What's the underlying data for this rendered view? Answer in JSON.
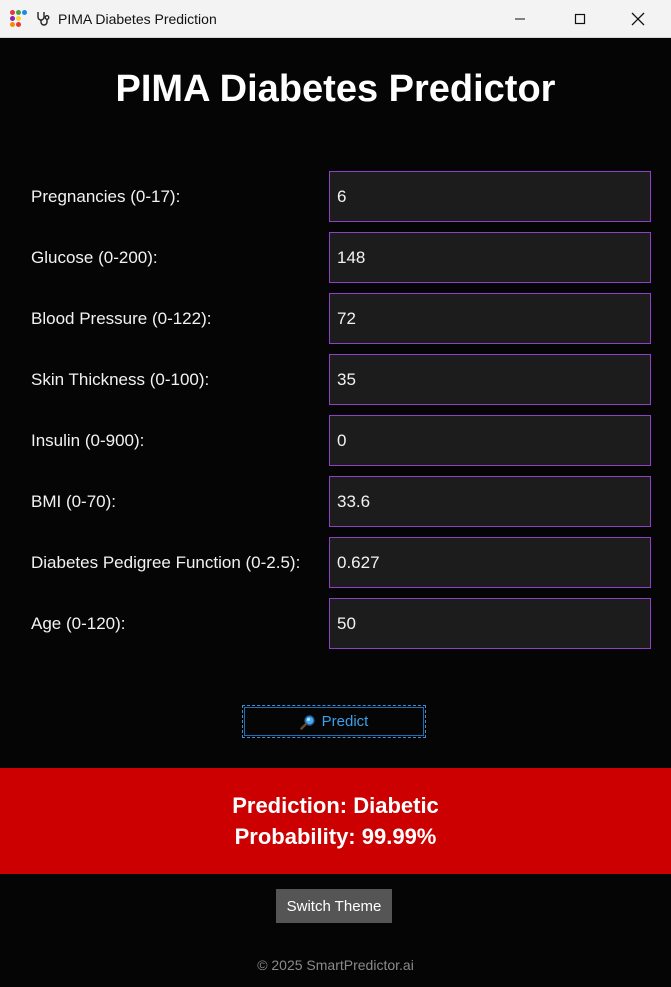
{
  "window": {
    "title": "PIMA Diabetes Prediction"
  },
  "app": {
    "heading": "PIMA Diabetes Predictor"
  },
  "fields": [
    {
      "label": "Pregnancies (0-17):",
      "value": "6"
    },
    {
      "label": "Glucose (0-200):",
      "value": "148"
    },
    {
      "label": "Blood Pressure (0-122):",
      "value": "72"
    },
    {
      "label": "Skin Thickness (0-100):",
      "value": "35"
    },
    {
      "label": "Insulin (0-900):",
      "value": "0"
    },
    {
      "label": "BMI (0-70):",
      "value": "33.6"
    },
    {
      "label": "Diabetes Pedigree Function (0-2.5):",
      "value": "0.627"
    },
    {
      "label": "Age (0-120):",
      "value": "50"
    }
  ],
  "predict_button": {
    "label": "Predict",
    "icon": "search-icon"
  },
  "result": {
    "prediction": "Prediction: Diabetic",
    "probability": "Probability: 99.99%"
  },
  "theme_button": {
    "label": "Switch Theme"
  },
  "footer": {
    "text": "© 2025 SmartPredictor.ai"
  },
  "colors": {
    "background": "#050505",
    "input_border": "#8f3fc8",
    "input_background": "#1c1c1c",
    "result_background": "#cc0000",
    "predict_text": "#3aa0ea",
    "theme_button_background": "#555555"
  }
}
